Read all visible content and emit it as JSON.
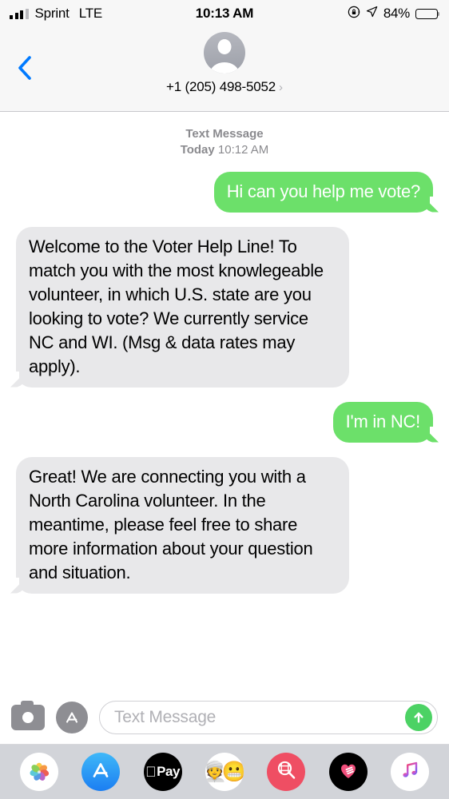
{
  "status_bar": {
    "carrier": "Sprint",
    "network": "LTE",
    "time": "10:13 AM",
    "battery_percent": "84%",
    "battery_level": 84,
    "signal_bars_filled": 3,
    "signal_bars_total": 4,
    "icons": [
      "signal-bars-icon",
      "rotation-lock-icon",
      "location-arrow-icon",
      "battery-icon"
    ]
  },
  "header": {
    "back_label": "‹",
    "contact": "+1 (205) 498-5052",
    "disclosure": "›",
    "avatar_icon": "person-placeholder-icon"
  },
  "conversation": {
    "timestamp": {
      "type": "Text Message",
      "day": "Today",
      "time": "10:12 AM"
    },
    "messages": [
      {
        "sender": "me",
        "text": "Hi can you help me vote?"
      },
      {
        "sender": "them",
        "text": "Welcome to the Voter Help Line! To match you with the most knowlegeable volunteer, in which U.S. state are you looking to vote? We currently service NC and WI. (Msg & data rates may apply)."
      },
      {
        "sender": "me",
        "text": "I'm in NC!"
      },
      {
        "sender": "them",
        "text": "Great! We are connecting you with a North Carolina volunteer. In the meantime, please feel free to share more information about your question and situation."
      }
    ]
  },
  "input_bar": {
    "camera_icon": "camera-icon",
    "appstore_icon": "app-store-icon",
    "placeholder": "Text Message",
    "value": "",
    "send_icon": "send-arrow-up-icon"
  },
  "app_drawer": {
    "apps": [
      {
        "name": "photos",
        "icon": "photos-icon",
        "label": "Photos"
      },
      {
        "name": "app-store",
        "icon": "app-store-icon",
        "label": "App Store"
      },
      {
        "name": "apple-pay",
        "icon": "apple-pay-icon",
        "label": "Pay"
      },
      {
        "name": "memoji",
        "icon": "memoji-icon",
        "label": "Memoji"
      },
      {
        "name": "images",
        "icon": "images-search-icon",
        "label": "#images"
      },
      {
        "name": "digital-touch",
        "icon": "digital-touch-icon",
        "label": "Digital Touch"
      },
      {
        "name": "music",
        "icon": "music-note-icon",
        "label": "Music"
      }
    ]
  },
  "colors": {
    "outgoing_bubble": "#6ce06a",
    "incoming_bubble": "#e8e8ea",
    "accent_blue": "#007aff",
    "send_button": "#4cd264",
    "header_bg": "#f7f7f7",
    "drawer_bg": "#d2d4d9"
  }
}
